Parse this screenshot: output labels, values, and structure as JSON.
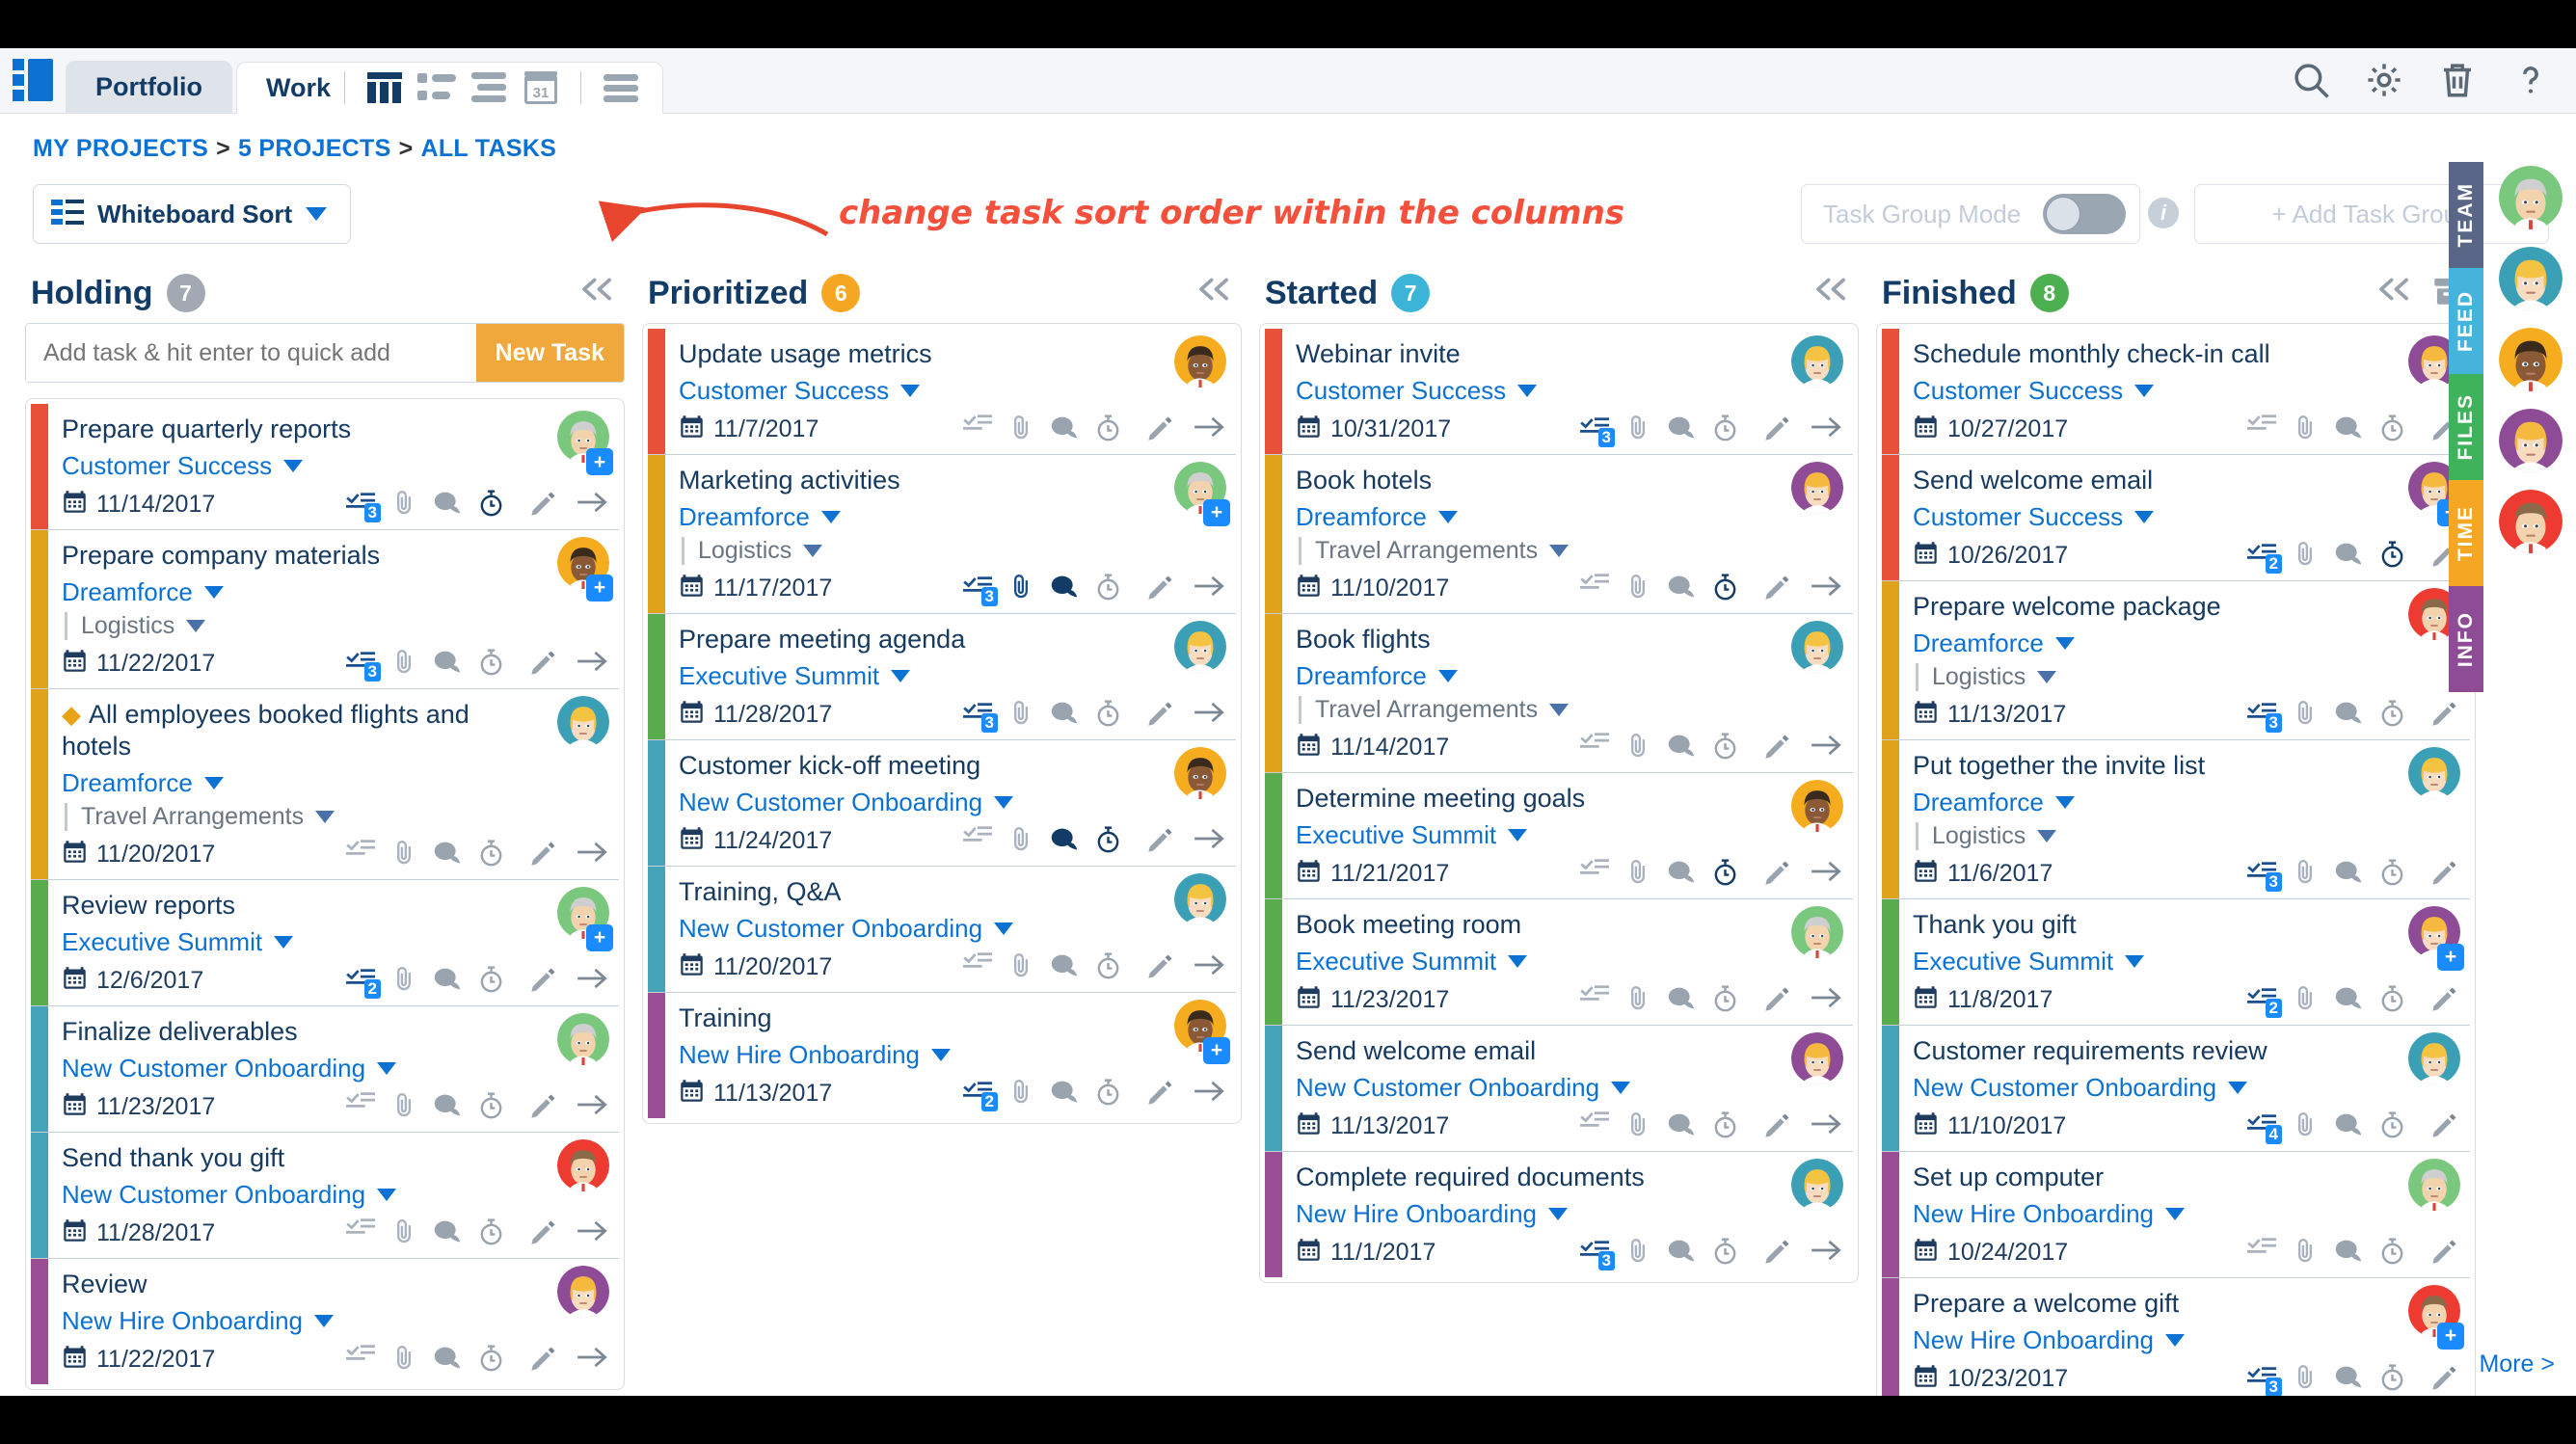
{
  "header": {
    "logo_name": "app-logo",
    "tabs": [
      {
        "label": "Portfolio",
        "active": false
      },
      {
        "label": "Work",
        "active": true
      }
    ],
    "view_icons": [
      "board-view-icon",
      "list-view-icon",
      "outline-view-icon",
      "calendar-view-icon",
      "menu-view-icon"
    ],
    "right_icons": [
      "search-icon",
      "gear-icon",
      "trash-icon",
      "help-icon"
    ]
  },
  "breadcrumb": {
    "items": [
      "MY PROJECTS",
      "5 PROJECTS",
      "ALL TASKS"
    ],
    "separator": ">"
  },
  "controls": {
    "sort_label": "Whiteboard Sort",
    "task_group_mode_label": "Task Group Mode",
    "task_group_mode_on": false,
    "info_badge": "i",
    "add_task_group_label": "+ Add Task Group"
  },
  "annotation": {
    "text": "change task sort order within the columns",
    "color": "#f4503c"
  },
  "quick_add": {
    "placeholder": "Add task & hit enter to quick add",
    "button_label": "New Task"
  },
  "colors": {
    "accent_blue": "#0b72d4",
    "orange": "#f0a83c",
    "holding_badge": "#a2a9b2",
    "prioritized_badge": "#f5a623",
    "started_badge": "#3cb4d8",
    "finished_badge": "#4cb050",
    "stripe_red": "#e8503a",
    "stripe_yellow": "#e0a21b",
    "stripe_green": "#5aab4e",
    "stripe_teal": "#44a3b8",
    "stripe_purple": "#9a4f94"
  },
  "columns": [
    {
      "title": "Holding",
      "count": "7",
      "badge_color": "#a2a9b2",
      "has_quick_add": true,
      "has_archive": false,
      "cards": [
        {
          "title": "Prepare quarterly reports",
          "project": "Customer Success",
          "sub": null,
          "date": "11/14/2017",
          "stripe": "#e8503a",
          "checklist": "3",
          "attach": false,
          "comment": false,
          "timer": true,
          "arrow": true,
          "plus": true,
          "avatar": "green"
        },
        {
          "title": "Prepare company materials",
          "project": "Dreamforce",
          "sub": "Logistics",
          "date": "11/22/2017",
          "stripe": "#e0a21b",
          "checklist": "3",
          "attach": false,
          "comment": false,
          "timer": false,
          "arrow": true,
          "plus": true,
          "avatar": "orange"
        },
        {
          "title": "All employees booked flights and hotels",
          "project": "Dreamforce",
          "sub": "Travel Arrangements",
          "date": "11/20/2017",
          "stripe": "#e0a21b",
          "checklist": null,
          "attach": false,
          "comment": false,
          "timer": false,
          "arrow": true,
          "plus": false,
          "avatar": "teal",
          "milestone": true
        },
        {
          "title": "Review reports",
          "project": "Executive Summit",
          "sub": null,
          "date": "12/6/2017",
          "stripe": "#5aab4e",
          "checklist": "2",
          "attach": false,
          "comment": false,
          "timer": false,
          "arrow": true,
          "plus": true,
          "avatar": "green"
        },
        {
          "title": "Finalize deliverables",
          "project": "New Customer Onboarding",
          "sub": null,
          "date": "11/23/2017",
          "stripe": "#44a3b8",
          "checklist": null,
          "attach": false,
          "comment": false,
          "timer": false,
          "arrow": true,
          "plus": false,
          "avatar": "green"
        },
        {
          "title": "Send thank you gift",
          "project": "New Customer Onboarding",
          "sub": null,
          "date": "11/28/2017",
          "stripe": "#44a3b8",
          "checklist": null,
          "attach": false,
          "comment": false,
          "timer": false,
          "arrow": true,
          "plus": false,
          "avatar": "red"
        },
        {
          "title": "Review",
          "project": "New Hire Onboarding",
          "sub": null,
          "date": "11/22/2017",
          "stripe": "#9a4f94",
          "checklist": null,
          "attach": false,
          "comment": false,
          "timer": false,
          "arrow": true,
          "plus": false,
          "avatar": "purple"
        }
      ]
    },
    {
      "title": "Prioritized",
      "count": "6",
      "badge_color": "#f5a623",
      "has_quick_add": false,
      "has_archive": false,
      "cards": [
        {
          "title": "Update usage metrics",
          "project": "Customer Success",
          "sub": null,
          "date": "11/7/2017",
          "stripe": "#e8503a",
          "checklist": null,
          "attach": false,
          "comment": false,
          "timer": false,
          "arrow": true,
          "plus": false,
          "avatar": "orange"
        },
        {
          "title": "Marketing activities",
          "project": "Dreamforce",
          "sub": "Logistics",
          "date": "11/17/2017",
          "stripe": "#e0a21b",
          "checklist": "3",
          "attach": true,
          "comment": true,
          "timer": false,
          "arrow": true,
          "plus": true,
          "avatar": "green"
        },
        {
          "title": "Prepare meeting agenda",
          "project": "Executive Summit",
          "sub": null,
          "date": "11/28/2017",
          "stripe": "#5aab4e",
          "checklist": "3",
          "attach": false,
          "comment": false,
          "timer": false,
          "arrow": true,
          "plus": false,
          "avatar": "teal"
        },
        {
          "title": "Customer kick-off meeting",
          "project": "New Customer Onboarding",
          "sub": null,
          "date": "11/24/2017",
          "stripe": "#44a3b8",
          "checklist": null,
          "attach": false,
          "comment": true,
          "timer": true,
          "arrow": true,
          "plus": false,
          "avatar": "orange"
        },
        {
          "title": "Training, Q&A",
          "project": "New Customer Onboarding",
          "sub": null,
          "date": "11/20/2017",
          "stripe": "#44a3b8",
          "checklist": null,
          "attach": false,
          "comment": false,
          "timer": false,
          "arrow": true,
          "plus": false,
          "avatar": "teal"
        },
        {
          "title": "Training",
          "project": "New Hire Onboarding",
          "sub": null,
          "date": "11/13/2017",
          "stripe": "#9a4f94",
          "checklist": "2",
          "attach": false,
          "comment": false,
          "timer": false,
          "arrow": true,
          "plus": true,
          "avatar": "orange"
        }
      ]
    },
    {
      "title": "Started",
      "count": "7",
      "badge_color": "#3cb4d8",
      "has_quick_add": false,
      "has_archive": false,
      "cards": [
        {
          "title": "Webinar invite",
          "project": "Customer Success",
          "sub": null,
          "date": "10/31/2017",
          "stripe": "#e8503a",
          "checklist": "3",
          "attach": false,
          "comment": false,
          "timer": false,
          "arrow": true,
          "plus": false,
          "avatar": "teal"
        },
        {
          "title": "Book hotels",
          "project": "Dreamforce",
          "sub": "Travel Arrangements",
          "date": "11/10/2017",
          "stripe": "#e0a21b",
          "checklist": null,
          "attach": false,
          "comment": false,
          "timer": true,
          "arrow": true,
          "plus": false,
          "avatar": "purple"
        },
        {
          "title": "Book flights",
          "project": "Dreamforce",
          "sub": "Travel Arrangements",
          "date": "11/14/2017",
          "stripe": "#e0a21b",
          "checklist": null,
          "attach": false,
          "comment": false,
          "timer": false,
          "arrow": true,
          "plus": false,
          "avatar": "teal"
        },
        {
          "title": "Determine meeting goals",
          "project": "Executive Summit",
          "sub": null,
          "date": "11/21/2017",
          "stripe": "#5aab4e",
          "checklist": null,
          "attach": false,
          "comment": false,
          "timer": true,
          "arrow": true,
          "plus": false,
          "avatar": "orange"
        },
        {
          "title": "Book meeting room",
          "project": "Executive Summit",
          "sub": null,
          "date": "11/23/2017",
          "stripe": "#5aab4e",
          "checklist": null,
          "attach": false,
          "comment": false,
          "timer": false,
          "arrow": true,
          "plus": false,
          "avatar": "green"
        },
        {
          "title": "Send welcome email",
          "project": "New Customer Onboarding",
          "sub": null,
          "date": "11/13/2017",
          "stripe": "#44a3b8",
          "checklist": null,
          "attach": false,
          "comment": false,
          "timer": false,
          "arrow": true,
          "plus": false,
          "avatar": "purple"
        },
        {
          "title": "Complete required documents",
          "project": "New Hire Onboarding",
          "sub": null,
          "date": "11/1/2017",
          "stripe": "#9a4f94",
          "checklist": "3",
          "attach": false,
          "comment": false,
          "timer": false,
          "arrow": true,
          "plus": false,
          "avatar": "teal"
        }
      ]
    },
    {
      "title": "Finished",
      "count": "8",
      "badge_color": "#4cb050",
      "has_quick_add": false,
      "has_archive": true,
      "cards": [
        {
          "title": "Schedule monthly check-in call",
          "project": "Customer Success",
          "sub": null,
          "date": "10/27/2017",
          "stripe": "#e8503a",
          "checklist": null,
          "attach": false,
          "comment": false,
          "timer": false,
          "arrow": false,
          "plus": false,
          "avatar": "purple"
        },
        {
          "title": "Send welcome email",
          "project": "Customer Success",
          "sub": null,
          "date": "10/26/2017",
          "stripe": "#e8503a",
          "checklist": "2",
          "attach": false,
          "comment": false,
          "timer": true,
          "arrow": false,
          "plus": true,
          "avatar": "purple"
        },
        {
          "title": "Prepare welcome package",
          "project": "Dreamforce",
          "sub": "Logistics",
          "date": "11/13/2017",
          "stripe": "#e0a21b",
          "checklist": "3",
          "attach": false,
          "comment": false,
          "timer": false,
          "arrow": false,
          "plus": false,
          "avatar": "red"
        },
        {
          "title": "Put together the invite list",
          "project": "Dreamforce",
          "sub": "Logistics",
          "date": "11/6/2017",
          "stripe": "#e0a21b",
          "checklist": "3",
          "attach": false,
          "comment": false,
          "timer": false,
          "arrow": false,
          "plus": false,
          "avatar": "teal"
        },
        {
          "title": "Thank you gift",
          "project": "Executive Summit",
          "sub": null,
          "date": "11/8/2017",
          "stripe": "#5aab4e",
          "checklist": "2",
          "attach": false,
          "comment": false,
          "timer": false,
          "arrow": false,
          "plus": true,
          "avatar": "purple"
        },
        {
          "title": "Customer requirements review",
          "project": "New Customer Onboarding",
          "sub": null,
          "date": "11/10/2017",
          "stripe": "#44a3b8",
          "checklist": "4",
          "attach": false,
          "comment": false,
          "timer": false,
          "arrow": false,
          "plus": false,
          "avatar": "teal"
        },
        {
          "title": "Set up computer",
          "project": "New Hire Onboarding",
          "sub": null,
          "date": "10/24/2017",
          "stripe": "#9a4f94",
          "checklist": null,
          "attach": false,
          "comment": false,
          "timer": false,
          "arrow": false,
          "plus": false,
          "avatar": "green"
        },
        {
          "title": "Prepare a welcome gift",
          "project": "New Hire Onboarding",
          "sub": null,
          "date": "10/23/2017",
          "stripe": "#9a4f94",
          "checklist": "3",
          "attach": false,
          "comment": false,
          "timer": false,
          "arrow": false,
          "plus": true,
          "avatar": "red"
        }
      ]
    }
  ],
  "rail": {
    "tabs": [
      {
        "label": "TEAM",
        "color": "#5a6687"
      },
      {
        "label": "FEED",
        "color": "#45b4dd"
      },
      {
        "label": "FILES",
        "color": "#3fb35b"
      },
      {
        "label": "TIME",
        "color": "#f5a623"
      },
      {
        "label": "INFO",
        "color": "#8e4b96"
      }
    ],
    "avatars": [
      "green",
      "teal",
      "orange",
      "purple",
      "red"
    ],
    "more_label": "More >"
  }
}
